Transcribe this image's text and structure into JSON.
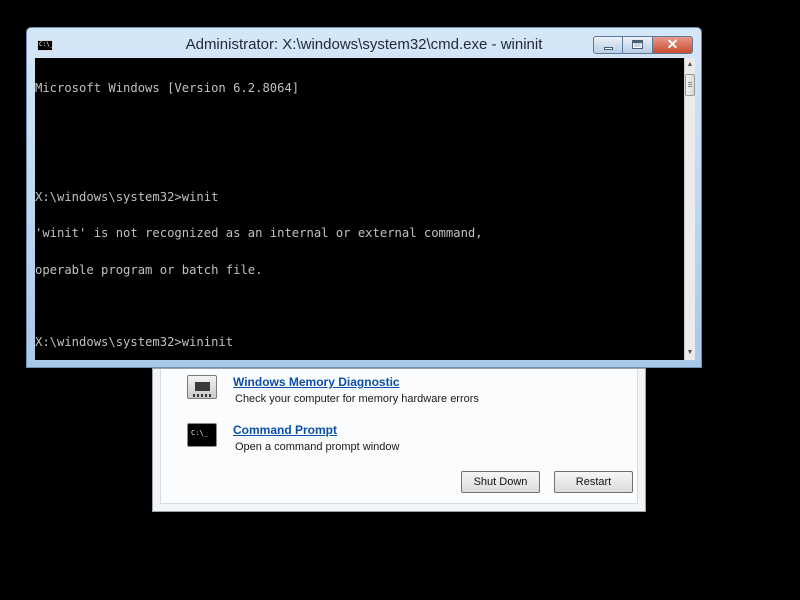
{
  "window": {
    "title": "Administrator: X:\\windows\\system32\\cmd.exe - wininit",
    "icon_label": "C:\\_",
    "close_glyph": "✕"
  },
  "console": {
    "lines": [
      "Microsoft Windows [Version 6.2.8064]",
      "",
      "",
      "X:\\windows\\system32>winit",
      "'winit' is not recognized as an internal or external command,",
      "operable program or batch file.",
      "",
      "X:\\windows\\system32>wininit"
    ]
  },
  "scrollbar": {
    "up_glyph": "▲",
    "down_glyph": "▼"
  },
  "recovery": {
    "options": [
      {
        "title": "Windows Memory Diagnostic",
        "description": "Check your computer for memory hardware errors",
        "icon": "memory-chip-icon"
      },
      {
        "title": "Command Prompt",
        "description": "Open a command prompt window",
        "icon": "command-prompt-icon",
        "icon_text": "C:\\_"
      }
    ],
    "buttons": {
      "shutdown": "Shut Down",
      "restart": "Restart"
    }
  },
  "colors": {
    "link": "#0b4fa8",
    "console_text": "#c0c0c0",
    "console_bg": "#000000",
    "close_button": "#c94b31"
  }
}
